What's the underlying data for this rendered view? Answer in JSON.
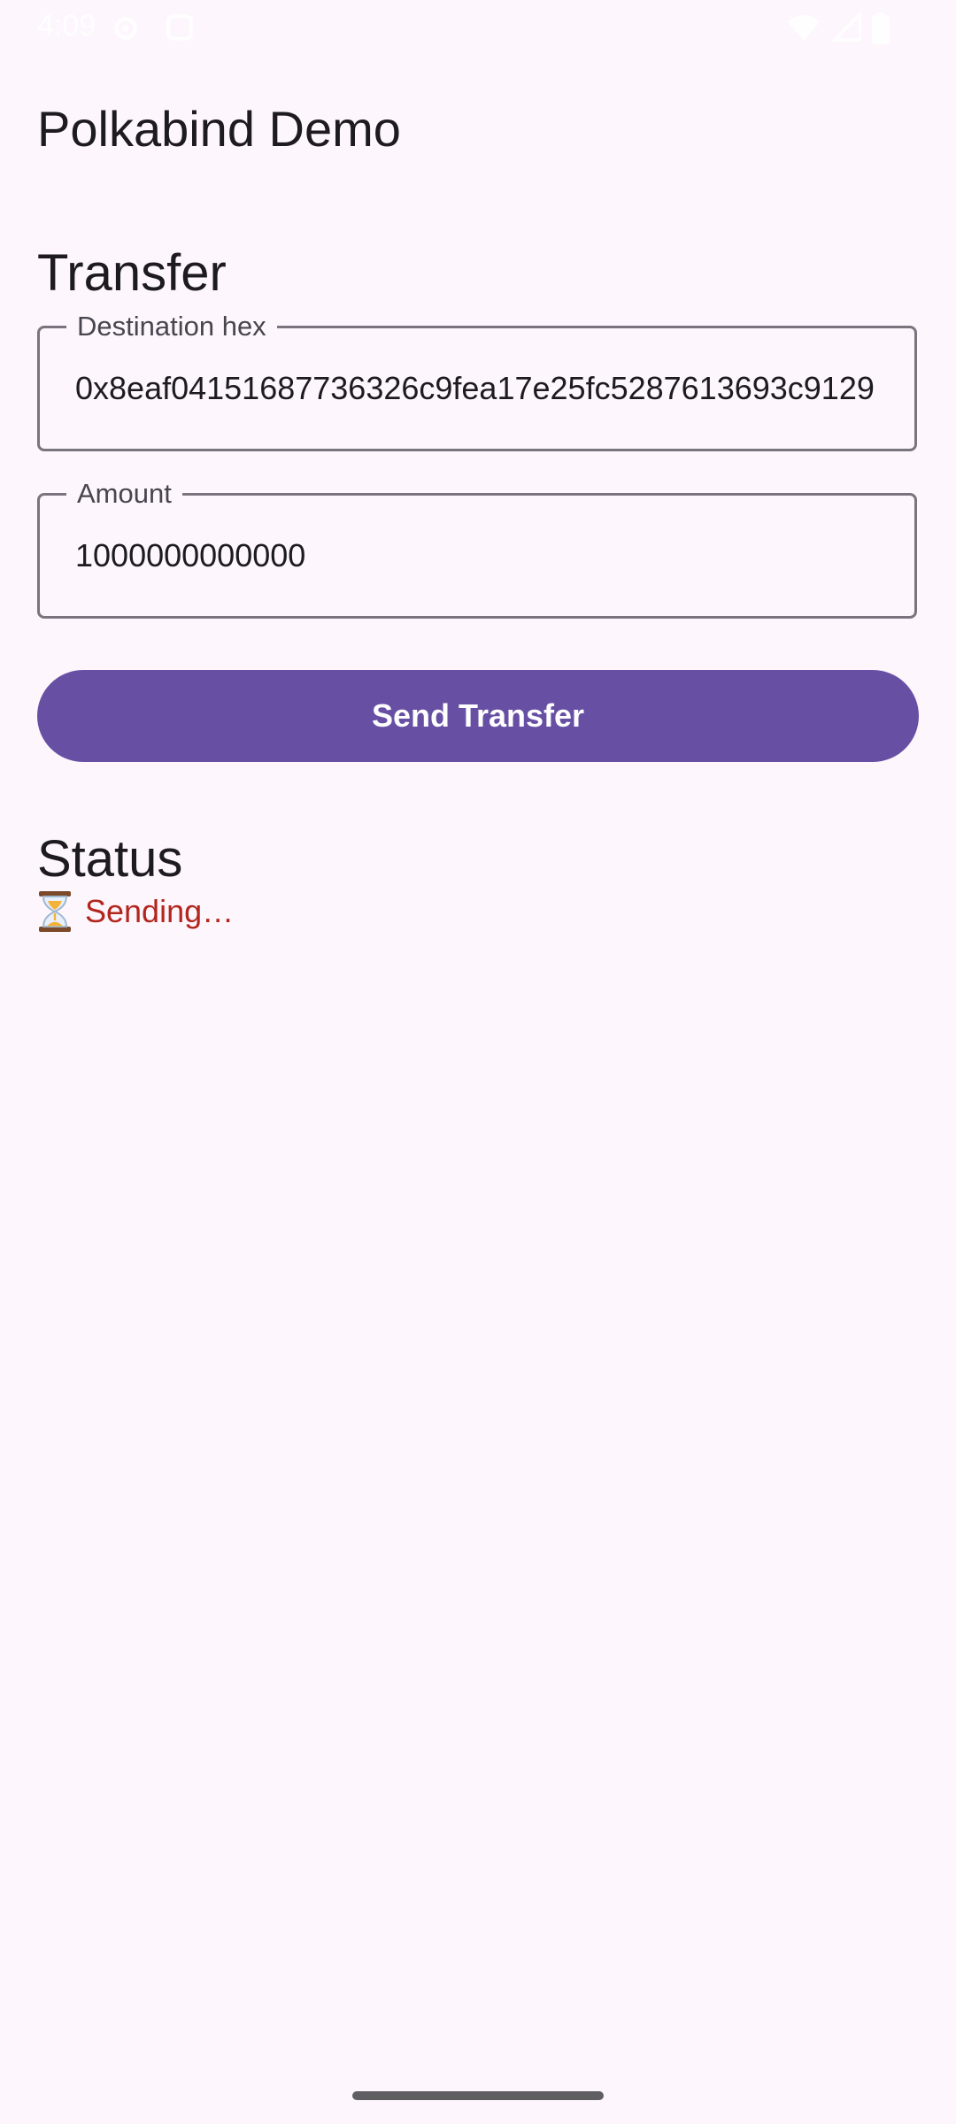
{
  "status_bar": {
    "time": "4:09"
  },
  "app": {
    "title": "Polkabind Demo"
  },
  "transfer": {
    "heading": "Transfer",
    "destination_label": "Destination hex",
    "destination_value": "0x8eaf04151687736326c9fea17e25fc5287613693c9129",
    "amount_label": "Amount",
    "amount_value": "1000000000000",
    "send_label": "Send Transfer"
  },
  "status": {
    "heading": "Status",
    "message": "Sending…"
  },
  "colors": {
    "background": "#fdf6fc",
    "primary": "#6750a4",
    "error_text": "#b3261e",
    "outline": "#79747e"
  },
  "icons": {
    "status_icon": "hourglass-icon"
  }
}
